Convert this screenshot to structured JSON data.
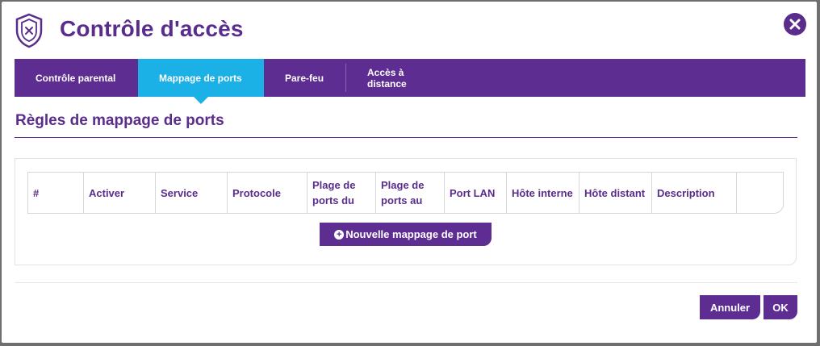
{
  "dialog": {
    "title": "Contrôle d'accès",
    "header_icon": "shield-icon",
    "close_icon": "close-icon"
  },
  "tabs": [
    {
      "label": "Contrôle parental",
      "active": false
    },
    {
      "label": "Mappage de ports",
      "active": true
    },
    {
      "label": "Pare-feu",
      "active": false
    },
    {
      "label": "Accès à distance",
      "active": false
    }
  ],
  "section": {
    "title": "Règles de mappage de ports"
  },
  "table": {
    "columns": [
      "#",
      "Activer",
      "Service",
      "Protocole",
      "Plage de ports du",
      "Plage de ports au",
      "Port LAN",
      "Hôte interne",
      "Hôte distant",
      "Description",
      ""
    ],
    "rows": []
  },
  "add_button": {
    "label": "Nouvelle mappage de port"
  },
  "footer": {
    "cancel_label": "Annuler",
    "ok_label": "OK"
  },
  "colors": {
    "brand_purple": "#5e2d91",
    "active_tab_blue": "#1bb0e6"
  }
}
